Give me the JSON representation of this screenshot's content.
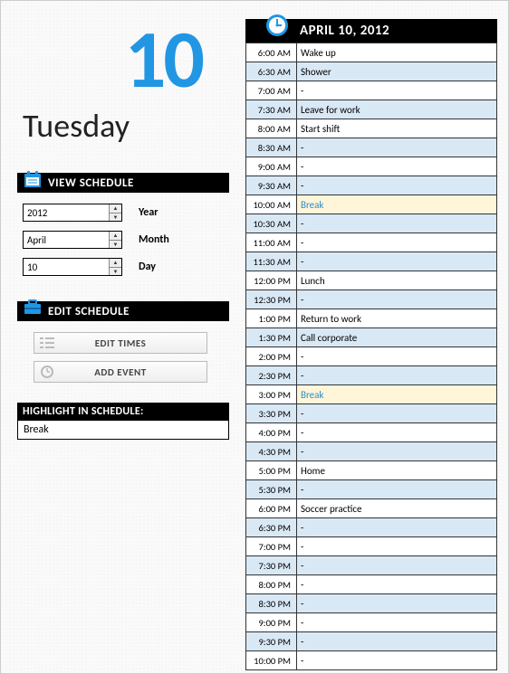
{
  "dayNumber": "10",
  "dayName": "Tuesday",
  "viewSchedule": {
    "header": "VIEW SCHEDULE",
    "year": {
      "value": "2012",
      "label": "Year"
    },
    "month": {
      "value": "April",
      "label": "Month"
    },
    "day": {
      "value": "10",
      "label": "Day"
    }
  },
  "editSchedule": {
    "header": "EDIT SCHEDULE",
    "editTimesLabel": "EDIT TIMES",
    "addEventLabel": "ADD EVENT"
  },
  "highlight": {
    "header": "HIGHLIGHT IN SCHEDULE:",
    "value": "Break"
  },
  "schedule": {
    "header": "APRIL 10, 2012",
    "rows": [
      {
        "time": "6:00 AM",
        "event": "Wake up"
      },
      {
        "time": "6:30 AM",
        "event": "Shower"
      },
      {
        "time": "7:00 AM",
        "event": "-"
      },
      {
        "time": "7:30 AM",
        "event": "Leave for work"
      },
      {
        "time": "8:00 AM",
        "event": "Start shift"
      },
      {
        "time": "8:30 AM",
        "event": "-"
      },
      {
        "time": "9:00 AM",
        "event": "-"
      },
      {
        "time": "9:30 AM",
        "event": "-"
      },
      {
        "time": "10:00 AM",
        "event": "Break",
        "highlight": true
      },
      {
        "time": "10:30 AM",
        "event": "-"
      },
      {
        "time": "11:00 AM",
        "event": "-"
      },
      {
        "time": "11:30 AM",
        "event": "-"
      },
      {
        "time": "12:00 PM",
        "event": "Lunch"
      },
      {
        "time": "12:30 PM",
        "event": "-"
      },
      {
        "time": "1:00 PM",
        "event": "Return to work"
      },
      {
        "time": "1:30 PM",
        "event": "Call corporate"
      },
      {
        "time": "2:00 PM",
        "event": "-"
      },
      {
        "time": "2:30 PM",
        "event": "-"
      },
      {
        "time": "3:00 PM",
        "event": "Break",
        "highlight": true
      },
      {
        "time": "3:30 PM",
        "event": "-"
      },
      {
        "time": "4:00 PM",
        "event": "-"
      },
      {
        "time": "4:30 PM",
        "event": "-"
      },
      {
        "time": "5:00 PM",
        "event": "Home"
      },
      {
        "time": "5:30 PM",
        "event": "-"
      },
      {
        "time": "6:00 PM",
        "event": "Soccer practice"
      },
      {
        "time": "6:30 PM",
        "event": "-"
      },
      {
        "time": "7:00 PM",
        "event": "-"
      },
      {
        "time": "7:30 PM",
        "event": "-"
      },
      {
        "time": "8:00 PM",
        "event": "-"
      },
      {
        "time": "8:30 PM",
        "event": "-"
      },
      {
        "time": "9:00 PM",
        "event": "-"
      },
      {
        "time": "9:30 PM",
        "event": "-"
      },
      {
        "time": "10:00 PM",
        "event": "-"
      }
    ]
  }
}
